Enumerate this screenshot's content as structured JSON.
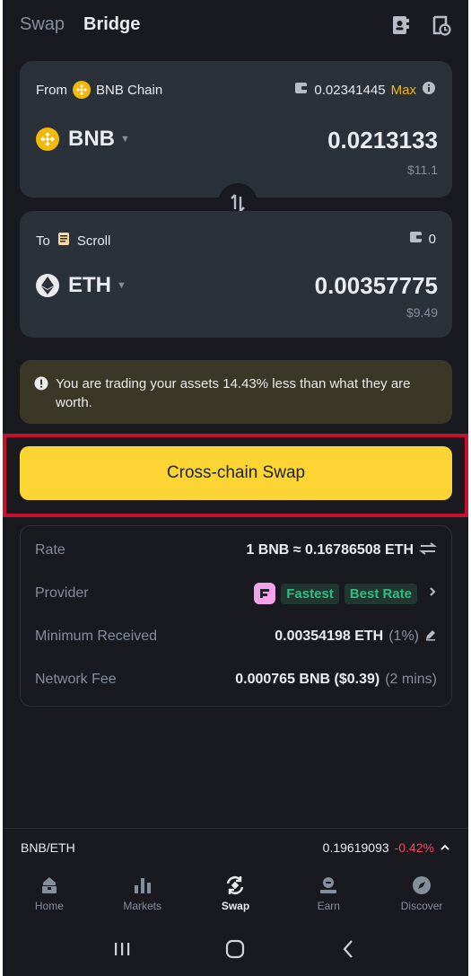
{
  "header": {
    "tab_swap": "Swap",
    "tab_bridge": "Bridge"
  },
  "from": {
    "label": "From",
    "chain": "BNB Chain",
    "balance": "0.02341445",
    "max_label": "Max",
    "token": "BNB",
    "amount": "0.0213133",
    "usd": "$11.1"
  },
  "to": {
    "label": "To",
    "chain": "Scroll",
    "balance": "0",
    "token": "ETH",
    "amount": "0.00357775",
    "usd": "$9.49"
  },
  "warning": {
    "text": "You are trading your assets 14.43% less than what they are worth."
  },
  "cta": {
    "label": "Cross-chain Swap"
  },
  "details": {
    "rate_label": "Rate",
    "rate_value": "1 BNB ≈ 0.16786508 ETH",
    "provider_label": "Provider",
    "provider_tag1": "Fastest",
    "provider_tag2": "Best Rate",
    "min_label": "Minimum Received",
    "min_value": "0.00354198 ETH",
    "min_slippage": "(1%)",
    "fee_label": "Network Fee",
    "fee_value": "0.000765 BNB ($0.39)",
    "fee_time": "(2 mins)"
  },
  "ticker": {
    "pair": "BNB/ETH",
    "price": "0.19619093",
    "change": "-0.42%"
  },
  "nav": [
    {
      "label": "Home",
      "icon": "home-icon"
    },
    {
      "label": "Markets",
      "icon": "markets-icon"
    },
    {
      "label": "Swap",
      "icon": "swap-icon"
    },
    {
      "label": "Earn",
      "icon": "earn-icon"
    },
    {
      "label": "Discover",
      "icon": "discover-icon"
    }
  ],
  "colors": {
    "accent": "#fcd535",
    "negative": "#f6465d",
    "positive": "#2ebd85",
    "highlight": "#c8102e"
  }
}
